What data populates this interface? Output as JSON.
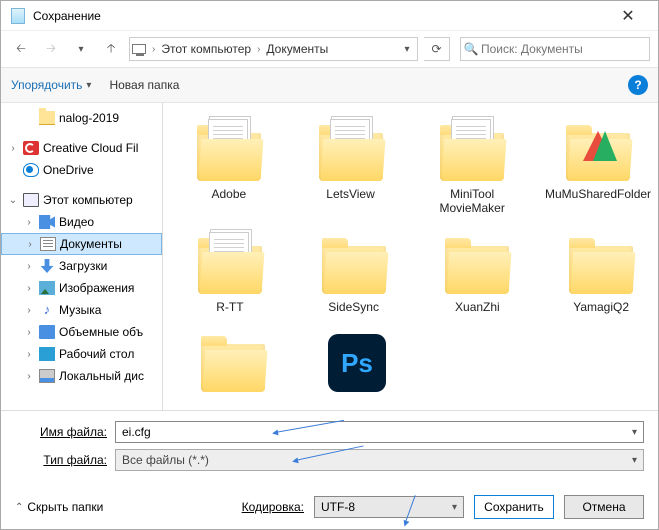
{
  "window": {
    "title": "Сохранение"
  },
  "nav": {
    "breadcrumb": {
      "root": "Этот компьютер",
      "current": "Документы"
    },
    "search_placeholder": "Поиск: Документы"
  },
  "toolbar": {
    "organize": "Упорядочить",
    "new_folder": "Новая папка"
  },
  "sidebar": {
    "items": [
      {
        "label": "nalog-2019",
        "icon": "folder",
        "twist": "",
        "indent": 1
      },
      {
        "label": "Creative Cloud Fil",
        "icon": "cc",
        "twist": "›",
        "indent": 0
      },
      {
        "label": "OneDrive",
        "icon": "cloud",
        "twist": "",
        "indent": 0
      },
      {
        "label": "Этот компьютер",
        "icon": "pc",
        "twist": "⌄",
        "indent": 0
      },
      {
        "label": "Видео",
        "icon": "vid",
        "twist": "›",
        "indent": 1
      },
      {
        "label": "Документы",
        "icon": "doc",
        "twist": "›",
        "indent": 1,
        "selected": true
      },
      {
        "label": "Загрузки",
        "icon": "dl",
        "twist": "›",
        "indent": 1
      },
      {
        "label": "Изображения",
        "icon": "img",
        "twist": "›",
        "indent": 1
      },
      {
        "label": "Музыка",
        "icon": "mus",
        "twist": "›",
        "indent": 1
      },
      {
        "label": "Объемные объ",
        "icon": "3d",
        "twist": "›",
        "indent": 1
      },
      {
        "label": "Рабочий стол",
        "icon": "desk",
        "twist": "›",
        "indent": 1
      },
      {
        "label": "Локальный дис",
        "icon": "disk",
        "twist": "›",
        "indent": 1
      }
    ]
  },
  "grid": {
    "row1": [
      {
        "label": "Adobe",
        "style": "papers"
      },
      {
        "label": "LetsView",
        "style": "papers"
      },
      {
        "label": "MiniTool MovieMaker",
        "style": "papers"
      },
      {
        "label": "MuMuSharedFolder",
        "style": "mumu"
      }
    ],
    "row2": [
      {
        "label": "R-TT",
        "style": "papers"
      },
      {
        "label": "SideSync",
        "style": "plain"
      },
      {
        "label": "XuanZhi",
        "style": "plain"
      },
      {
        "label": "YamagiQ2",
        "style": "plain"
      }
    ],
    "row3": [
      {
        "label": "",
        "style": "plain"
      },
      {
        "label": "",
        "style": "ps"
      }
    ]
  },
  "form": {
    "filename_label": "Имя файла:",
    "filename_value": "ei.cfg",
    "filetype_label": "Тип файла:",
    "filetype_value": "Все файлы  (*.*)"
  },
  "footer": {
    "hide_folders": "Скрыть папки",
    "encoding_label": "Кодировка:",
    "encoding_value": "UTF-8",
    "save": "Сохранить",
    "cancel": "Отмена"
  }
}
